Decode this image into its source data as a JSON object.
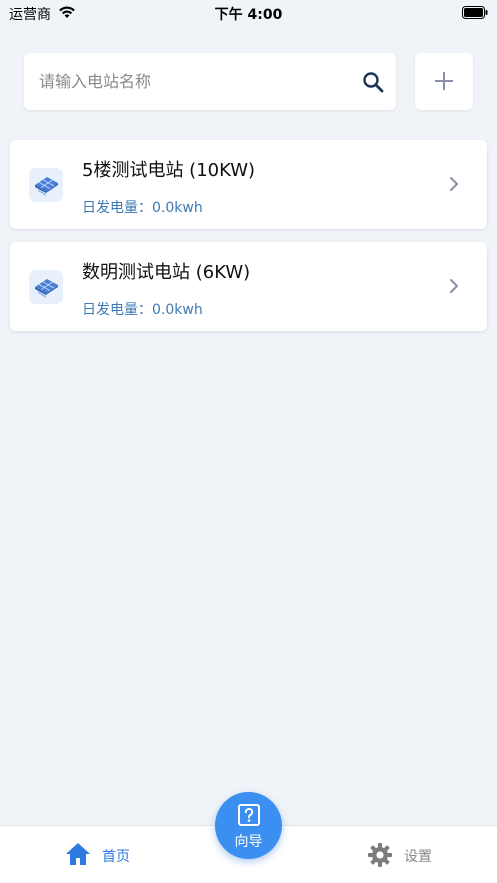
{
  "status_bar": {
    "carrier": "运营商",
    "time": "下午 4:00"
  },
  "search": {
    "placeholder": "请输入电站名称",
    "value": ""
  },
  "stations": [
    {
      "name": "5楼测试电站 (10KW)",
      "power_label": "日发电量：0.0kwh"
    },
    {
      "name": "数明测试电站 (6KW)",
      "power_label": "日发电量：0.0kwh"
    }
  ],
  "tab_bar": {
    "home_label": "首页",
    "guide_label": "向导",
    "settings_label": "设置"
  },
  "colors": {
    "accent": "#2d7be0",
    "guide_button": "#3b8ff0",
    "power_text": "#3f7ab3",
    "background": "#f0f4f8"
  },
  "icons": [
    "wifi-icon",
    "battery-icon",
    "search-icon",
    "add-icon",
    "solar-panel-icon",
    "chevron-right-icon",
    "home-icon",
    "help-icon",
    "gear-icon"
  ]
}
